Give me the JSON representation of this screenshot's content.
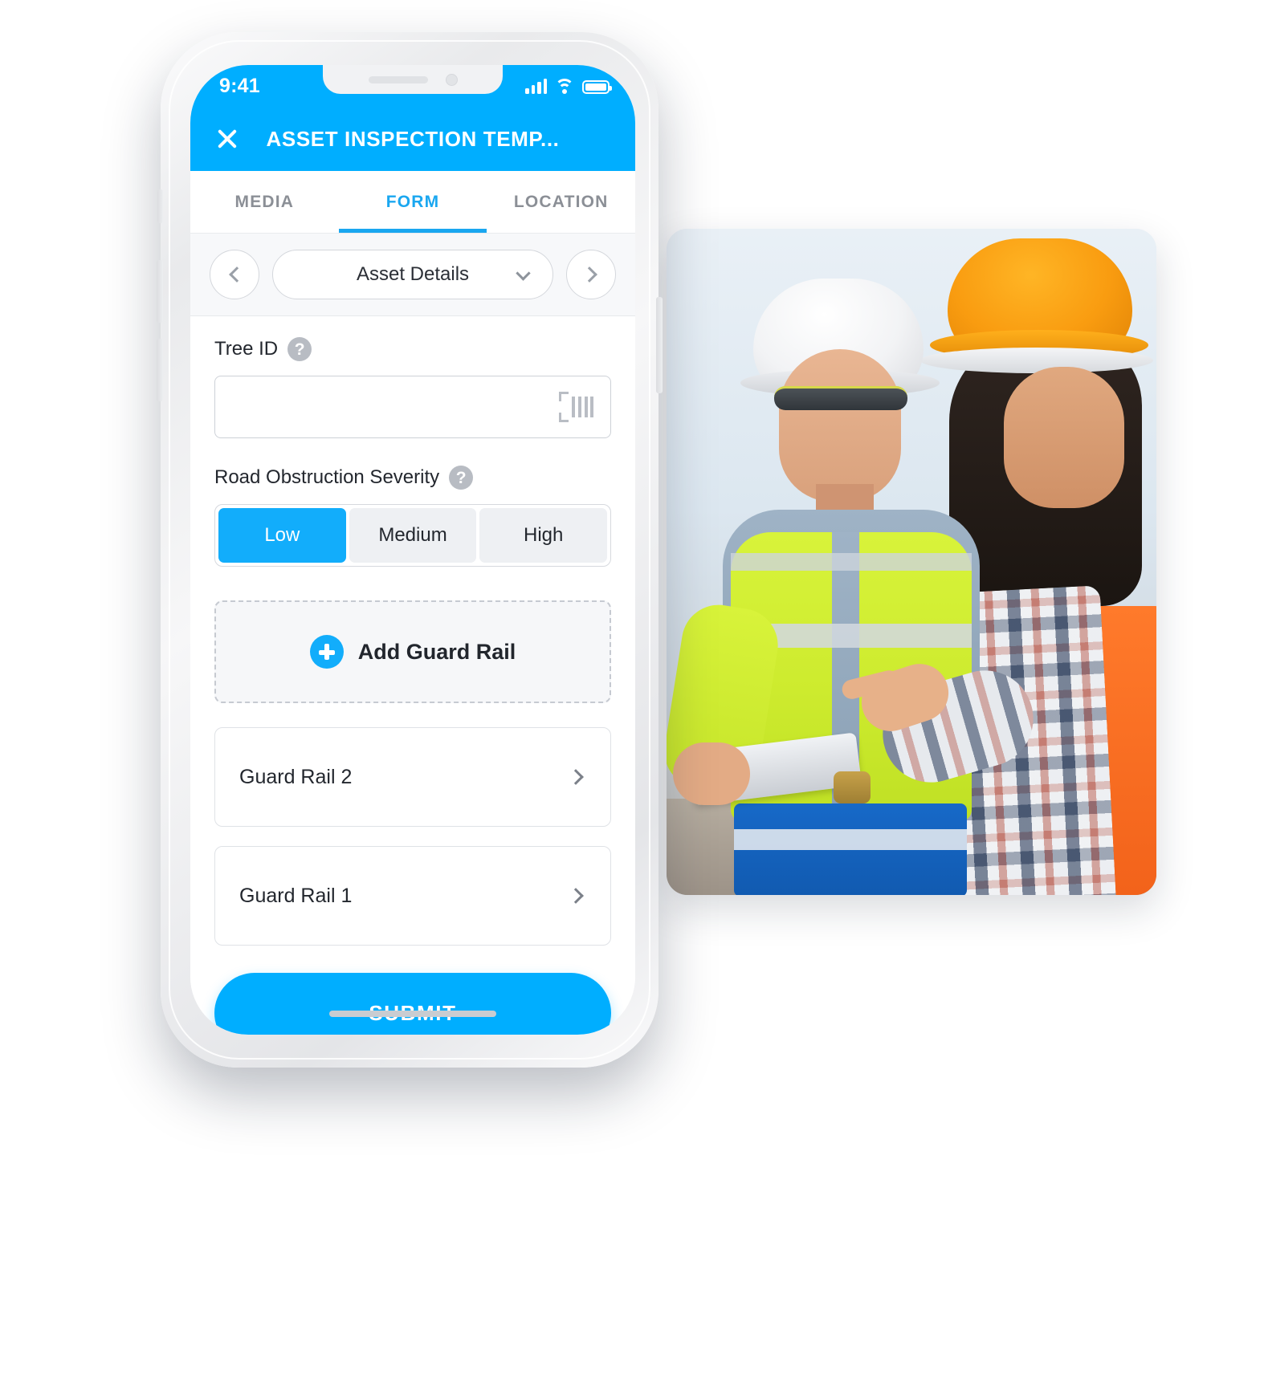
{
  "status_bar": {
    "time": "9:41",
    "signal_icon": "cellular-signal-icon",
    "wifi_icon": "wifi-icon",
    "battery_icon": "battery-icon"
  },
  "app_bar": {
    "close_icon": "close-icon",
    "title": "ASSET INSPECTION TEMP..."
  },
  "tabs": [
    {
      "label": "MEDIA",
      "active": false
    },
    {
      "label": "FORM",
      "active": true
    },
    {
      "label": "LOCATION",
      "active": false
    }
  ],
  "page_selector": {
    "prev_icon": "chevron-left-icon",
    "next_icon": "chevron-right-icon",
    "selected_page": "Asset Details",
    "dropdown_icon": "chevron-down-icon"
  },
  "form": {
    "tree_id": {
      "label": "Tree ID",
      "help_icon": "help-circle-icon",
      "value": "",
      "placeholder": "",
      "scan_icon": "barcode-scan-icon"
    },
    "severity": {
      "label": "Road Obstruction Severity",
      "help_icon": "help-circle-icon",
      "options": [
        "Low",
        "Medium",
        "High"
      ],
      "selected": "Low"
    },
    "add_guard_rail": {
      "label": "Add Guard Rail",
      "icon": "plus-circle-icon"
    },
    "guard_rails": [
      {
        "label": "Guard Rail  2",
        "chevron_icon": "chevron-right-icon"
      },
      {
        "label": "Guard Rail  1",
        "chevron_icon": "chevron-right-icon"
      }
    ],
    "submit_label": "SUBMIT"
  },
  "colors": {
    "accent": "#00AEFF",
    "accent_light": "#12ADFB",
    "tab_active": "#1aa7f0",
    "text": "#23272e",
    "muted": "#8b8f96"
  }
}
